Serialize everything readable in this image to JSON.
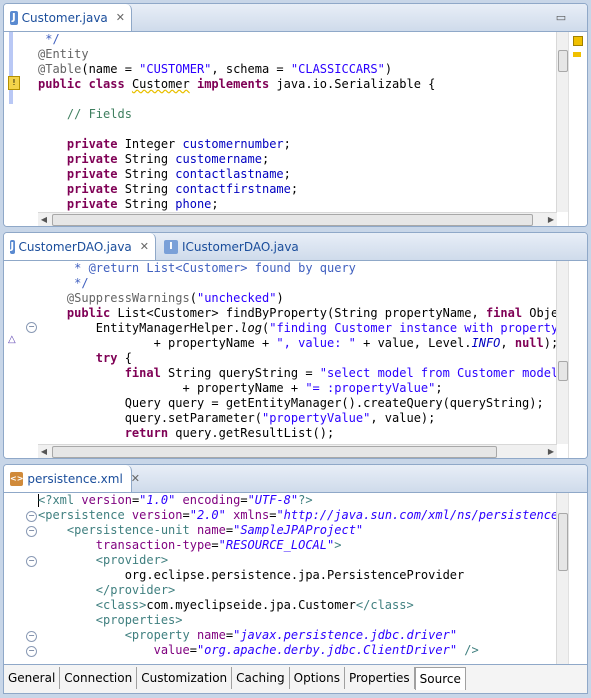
{
  "editor1": {
    "tab_label": "Customer.java",
    "tab_close": "✕",
    "lines": [
      [
        [
          "jd",
          " */"
        ]
      ],
      [
        [
          "ann",
          "@Entity"
        ]
      ],
      [
        [
          "ann",
          "@Table"
        ],
        [
          "",
          "(name = "
        ],
        [
          "str",
          "\"CUSTOMER\""
        ],
        [
          "",
          ", schema = "
        ],
        [
          "str",
          "\"CLASSICCARS\""
        ],
        [
          "",
          ")"
        ]
      ],
      [
        [
          "kw",
          "public"
        ],
        [
          "",
          " "
        ],
        [
          "kw",
          "class"
        ],
        [
          "",
          " "
        ],
        [
          "warn",
          "Customer"
        ],
        [
          "",
          " "
        ],
        [
          "kw",
          "implements"
        ],
        [
          "",
          " java.io.Serializable {"
        ]
      ],
      [
        [
          "",
          ""
        ]
      ],
      [
        [
          "",
          "    "
        ],
        [
          "cm",
          "// Fields"
        ]
      ],
      [
        [
          "",
          ""
        ]
      ],
      [
        [
          "",
          "    "
        ],
        [
          "kw",
          "private"
        ],
        [
          "",
          " Integer "
        ],
        [
          "field",
          "customernumber"
        ],
        [
          "",
          ";"
        ]
      ],
      [
        [
          "",
          "    "
        ],
        [
          "kw",
          "private"
        ],
        [
          "",
          " String "
        ],
        [
          "field",
          "customername"
        ],
        [
          "",
          ";"
        ]
      ],
      [
        [
          "",
          "    "
        ],
        [
          "kw",
          "private"
        ],
        [
          "",
          " String "
        ],
        [
          "field",
          "contactlastname"
        ],
        [
          "",
          ";"
        ]
      ],
      [
        [
          "",
          "    "
        ],
        [
          "kw",
          "private"
        ],
        [
          "",
          " String "
        ],
        [
          "field",
          "contactfirstname"
        ],
        [
          "",
          ";"
        ]
      ],
      [
        [
          "",
          "    "
        ],
        [
          "kw",
          "private"
        ],
        [
          "",
          " String "
        ],
        [
          "field",
          "phone"
        ],
        [
          "",
          ";"
        ]
      ]
    ]
  },
  "editor2": {
    "tab1_label": "CustomerDAO.java",
    "tab1_close": "✕",
    "tab2_label": "ICustomerDAO.java",
    "lines": [
      [
        [
          "jd",
          "     * "
        ],
        [
          "jd",
          "@return"
        ],
        [
          "jd",
          " List<Customer> found by query"
        ]
      ],
      [
        [
          "jd",
          "     */"
        ]
      ],
      [
        [
          "",
          "    "
        ],
        [
          "ann",
          "@SuppressWarnings"
        ],
        [
          "",
          "("
        ],
        [
          "str",
          "\"unchecked\""
        ],
        [
          "",
          ")"
        ]
      ],
      [
        [
          "",
          "    "
        ],
        [
          "kw",
          "public"
        ],
        [
          "",
          " List<Customer> findByProperty(String propertyName, "
        ],
        [
          "kw",
          "final"
        ],
        [
          "",
          " Object"
        ]
      ],
      [
        [
          "",
          "        EntityManagerHelper."
        ],
        [
          "it",
          "log"
        ],
        [
          "",
          "("
        ],
        [
          "str",
          "\"finding Customer instance with property: "
        ]
      ],
      [
        [
          "",
          "                + propertyName + "
        ],
        [
          "str",
          "\", value: \""
        ],
        [
          "",
          " + value, Level."
        ],
        [
          "field it",
          "INFO"
        ],
        [
          "",
          ", "
        ],
        [
          "kw",
          "null"
        ],
        [
          "",
          ");"
        ]
      ],
      [
        [
          "",
          "        "
        ],
        [
          "kw",
          "try"
        ],
        [
          "",
          " {"
        ]
      ],
      [
        [
          "",
          "            "
        ],
        [
          "kw",
          "final"
        ],
        [
          "",
          " String queryString = "
        ],
        [
          "str",
          "\"select model from Customer model w"
        ]
      ],
      [
        [
          "",
          "                    + propertyName + "
        ],
        [
          "str",
          "\"= :propertyValue\""
        ],
        [
          "",
          ";"
        ]
      ],
      [
        [
          "",
          "            Query query = getEntityManager().createQuery(queryString);"
        ]
      ],
      [
        [
          "",
          "            query.setParameter("
        ],
        [
          "str",
          "\"propertyValue\""
        ],
        [
          "",
          ", value);"
        ]
      ],
      [
        [
          "",
          "            "
        ],
        [
          "kw",
          "return"
        ],
        [
          "",
          " query.getResultList();"
        ]
      ]
    ]
  },
  "editor3": {
    "tab_label": "persistence.xml",
    "tab_close": "✕",
    "lines": [
      [
        [
          "xmltag",
          "<?xml "
        ],
        [
          "xmlattr",
          "version"
        ],
        [
          "",
          "="
        ],
        [
          "xmlval",
          "\"1.0\""
        ],
        [
          "",
          " "
        ],
        [
          "xmlattr",
          "encoding"
        ],
        [
          "",
          "="
        ],
        [
          "xmlval",
          "\"UTF-8\""
        ],
        [
          "xmltag",
          "?>"
        ]
      ],
      [
        [
          "xmltag",
          "<persistence "
        ],
        [
          "xmlattr",
          "version"
        ],
        [
          "",
          "="
        ],
        [
          "xmlval",
          "\"2.0\""
        ],
        [
          "",
          " "
        ],
        [
          "xmlattr",
          "xmlns"
        ],
        [
          "",
          "="
        ],
        [
          "xmlval",
          "\"http://java.sun.com/xml/ns/persistence\""
        ]
      ],
      [
        [
          "",
          "    "
        ],
        [
          "xmltag",
          "<persistence-unit "
        ],
        [
          "xmlattr",
          "name"
        ],
        [
          "",
          "="
        ],
        [
          "xmlval",
          "\"SampleJPAProject\""
        ]
      ],
      [
        [
          "",
          "        "
        ],
        [
          "xmlattr",
          "transaction-type"
        ],
        [
          "",
          "="
        ],
        [
          "xmlval",
          "\"RESOURCE_LOCAL\""
        ],
        [
          "xmltag",
          ">"
        ]
      ],
      [
        [
          "",
          "        "
        ],
        [
          "xmltag",
          "<provider>"
        ]
      ],
      [
        [
          "",
          "            "
        ],
        [
          "xmltext",
          "org.eclipse.persistence.jpa.PersistenceProvider"
        ]
      ],
      [
        [
          "",
          "        "
        ],
        [
          "xmltag",
          "</provider>"
        ]
      ],
      [
        [
          "",
          "        "
        ],
        [
          "xmltag",
          "<class>"
        ],
        [
          "xmltext",
          "com.myeclipseide.jpa.Customer"
        ],
        [
          "xmltag",
          "</class>"
        ]
      ],
      [
        [
          "",
          "        "
        ],
        [
          "xmltag",
          "<properties>"
        ]
      ],
      [
        [
          "",
          "            "
        ],
        [
          "xmltag",
          "<property "
        ],
        [
          "xmlattr",
          "name"
        ],
        [
          "",
          "="
        ],
        [
          "xmlval",
          "\"javax.persistence.jdbc.driver\""
        ]
      ],
      [
        [
          "",
          "                "
        ],
        [
          "xmlattr",
          "value"
        ],
        [
          "",
          "="
        ],
        [
          "xmlval",
          "\"org.apache.derby.jdbc.ClientDriver\""
        ],
        [
          "xmltag",
          " />"
        ]
      ]
    ]
  },
  "bottom_tabs": [
    "General",
    "Connection",
    "Customization",
    "Caching",
    "Options",
    "Properties",
    "Source"
  ],
  "active_bottom_tab": "Source"
}
